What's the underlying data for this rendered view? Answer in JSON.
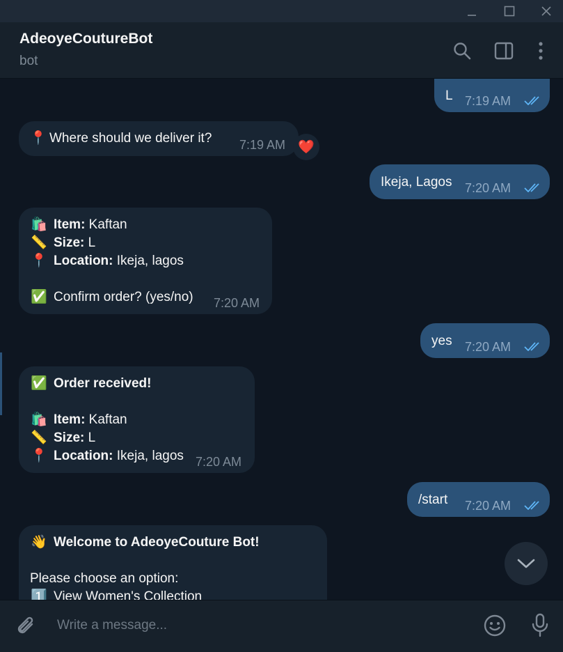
{
  "window": {
    "minimize_glyph": "—",
    "maximize_glyph": "☐",
    "close_glyph": "✕"
  },
  "header": {
    "title": "AdeoyeCoutureBot",
    "subtitle": "bot"
  },
  "messages": [
    {
      "dir": "out",
      "text": "L",
      "time": "7:19 AM"
    },
    {
      "dir": "in",
      "emoji": "📍",
      "text": "Where should we deliver it?",
      "time": "7:19 AM",
      "reaction": "❤️"
    },
    {
      "dir": "out",
      "text": "Ikeja, Lagos",
      "time": "7:20 AM"
    },
    {
      "dir": "in",
      "lines": [
        {
          "emoji": "🛍️",
          "label": "Item:",
          "value": " Kaftan"
        },
        {
          "emoji": "📏",
          "label": "Size:",
          "value": " L"
        },
        {
          "emoji": "📍",
          "label": "Location:",
          "value": " Ikeja, lagos"
        },
        {
          "emoji": "✅",
          "text": "Confirm order? (yes/no)"
        }
      ],
      "time": "7:20 AM"
    },
    {
      "dir": "out",
      "text": "yes",
      "time": "7:20 AM"
    },
    {
      "dir": "in",
      "lines": [
        {
          "emoji": "✅",
          "label": "Order received!"
        },
        {
          "emoji": "🛍️",
          "label": "Item:",
          "value": " Kaftan"
        },
        {
          "emoji": "📏",
          "label": "Size:",
          "value": " L"
        },
        {
          "emoji": "📍",
          "label": "Location:",
          "value": " Ikeja, lagos"
        }
      ],
      "time": "7:20 AM"
    },
    {
      "dir": "out",
      "text": "/start",
      "time": "7:20 AM"
    },
    {
      "dir": "in",
      "lines": [
        {
          "emoji": "👋",
          "label": "Welcome to AdeoyeCouture Bot!"
        },
        {
          "text": "Please choose an option:"
        },
        {
          "emoji": "1️⃣",
          "text": "View Women's Collection"
        }
      ]
    }
  ],
  "composer": {
    "placeholder": "Write a message..."
  },
  "icons": [
    "search-icon",
    "sidebar-toggle-icon",
    "more-options-icon",
    "attach-icon",
    "emoji-icon",
    "microphone-icon",
    "chevron-down-icon",
    "double-check-icon"
  ],
  "colors": {
    "background": "#0e1621",
    "header": "#17212b",
    "incoming_bubble": "#182533",
    "outgoing_bubble": "#2b5278",
    "check_blue": "#5eb5f7"
  }
}
